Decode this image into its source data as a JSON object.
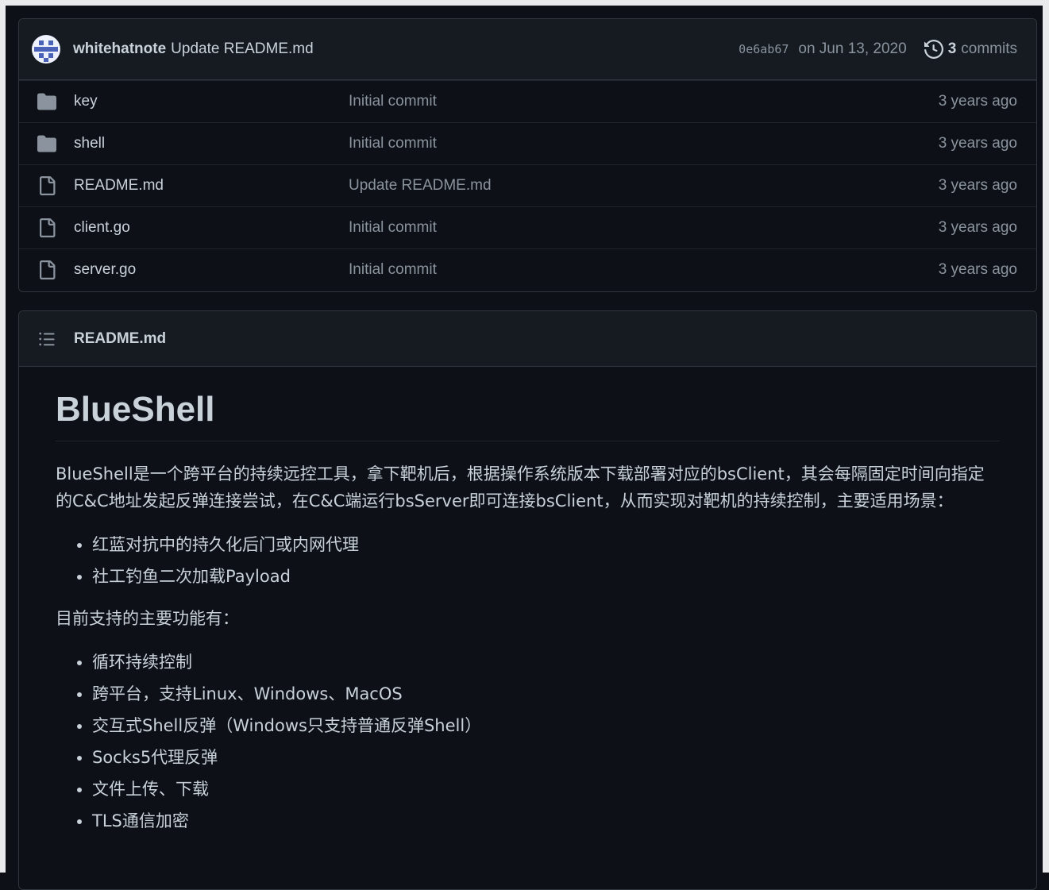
{
  "latest_commit": {
    "author": "whitehatnote",
    "message": "Update README.md",
    "sha": "0e6ab67",
    "date": "on Jun 13, 2020",
    "commit_count": "3",
    "commit_count_label": "commits",
    "avatar_icon": "identicon-avatar",
    "history_icon": "history-icon"
  },
  "files": [
    {
      "name": "key",
      "type": "folder",
      "icon": "folder-icon",
      "commit": "Initial commit",
      "age": "3 years ago"
    },
    {
      "name": "shell",
      "type": "folder",
      "icon": "folder-icon",
      "commit": "Initial commit",
      "age": "3 years ago"
    },
    {
      "name": "README.md",
      "type": "file",
      "icon": "file-icon",
      "commit": "Update README.md",
      "age": "3 years ago"
    },
    {
      "name": "client.go",
      "type": "file",
      "icon": "file-icon",
      "commit": "Initial commit",
      "age": "3 years ago"
    },
    {
      "name": "server.go",
      "type": "file",
      "icon": "file-icon",
      "commit": "Initial commit",
      "age": "3 years ago"
    }
  ],
  "readme": {
    "filename": "README.md",
    "header_icon": "list-unordered-icon",
    "title": "BlueShell",
    "intro": "BlueShell是一个跨平台的持续远控工具，拿下靶机后，根据操作系统版本下载部署对应的bsClient，其会每隔固定时间向指定的C&C地址发起反弹连接尝试，在C&C端运行bsServer即可连接bsClient，从而实现对靶机的持续控制，主要适用场景：",
    "scenarios": [
      "红蓝对抗中的持久化后门或内网代理",
      "社工钓鱼二次加载Payload"
    ],
    "features_heading": "目前支持的主要功能有：",
    "features": [
      "循环持续控制",
      "跨平台，支持Linux、Windows、MacOS",
      "交互式Shell反弹（Windows只支持普通反弹Shell）",
      "Socks5代理反弹",
      "文件上传、下载",
      "TLS通信加密"
    ]
  },
  "colors": {
    "background": "#0d1117",
    "header_bg": "#161b22",
    "border": "#30363d",
    "text": "#c9d1d9",
    "muted": "#8b949e",
    "folder": "#8b949e"
  }
}
